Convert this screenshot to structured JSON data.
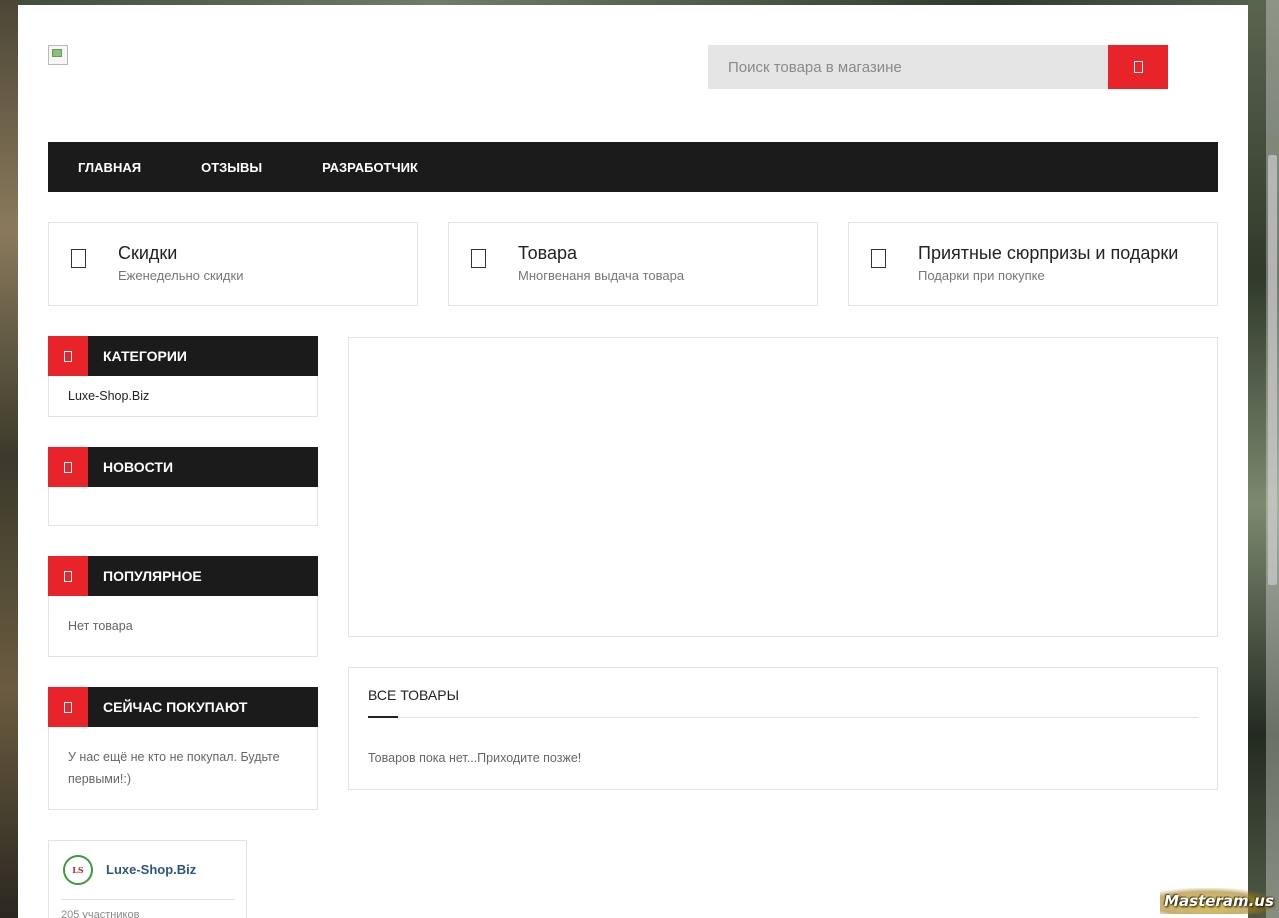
{
  "search": {
    "placeholder": "Поиск товара в магазине"
  },
  "nav": {
    "items": [
      "Главная",
      "Отзывы",
      "Разработчик"
    ]
  },
  "features": [
    {
      "title": "Скидки",
      "subtitle": "Еженедельно скидки"
    },
    {
      "title": "Товара",
      "subtitle": "Многвенаня выдача товара"
    },
    {
      "title": "Приятные сюрпризы и подарки",
      "subtitle": "Подарки при покупке"
    }
  ],
  "widgets": {
    "categories": {
      "title": "Категории",
      "link": "Luxe-Shop.Biz"
    },
    "news": {
      "title": "Новости"
    },
    "popular": {
      "title": "Популярное",
      "text": "Нет товара"
    },
    "buying_now": {
      "title": "Сейчас покупают",
      "text": "У нас ещё не кто не покупал. Будьте первыми!:)"
    }
  },
  "all_goods": {
    "title": "Все товары",
    "empty_text": "Товаров пока нет...Приходите позже!"
  },
  "vk_widget": {
    "group_name": "Luxe-Shop.Biz",
    "members": "205 участников"
  },
  "watermark": "Masteram.us",
  "colors": {
    "accent": "#e8242a",
    "nav_bg": "#1b1b1b",
    "search_bg": "#e5e5e5"
  }
}
